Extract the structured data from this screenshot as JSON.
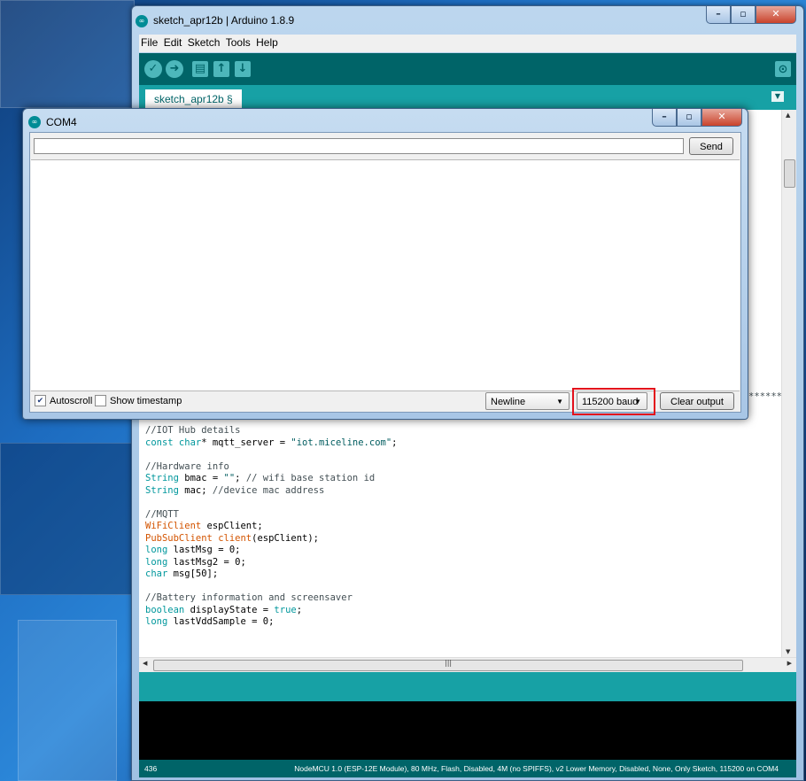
{
  "arduino": {
    "title": "sketch_apr12b | Arduino 1.8.9",
    "menu": [
      "File",
      "Edit",
      "Sketch",
      "Tools",
      "Help"
    ],
    "tab_label": "sketch_apr12b §",
    "code_lines": [
      "//IOT Hub details",
      "const char* mqtt_server = \"iot.miceline.com\";",
      "",
      "//Hardware info",
      "String bmac = \"\"; // wifi base station id",
      "String mac; //device mac address",
      "",
      "//MQTT",
      "WiFiClient espClient;",
      "PubSubClient client(espClient);",
      "long lastMsg = 0;",
      "long lastMsg2 = 0;",
      "char msg[50];",
      "",
      "//Battery information and screensaver",
      "boolean displayState = true;",
      "long lastVddSample = 0;"
    ],
    "stars_fragment": "*******",
    "line_number": "436",
    "board_info": "NodeMCU 1.0 (ESP-12E Module), 80 MHz, Flash, Disabled, 4M (no SPIFFS), v2 Lower Memory, Disabled, None, Only Sketch, 115200 on COM4"
  },
  "serial_monitor": {
    "title": "COM4",
    "input_value": "",
    "send_label": "Send",
    "autoscroll_label": "Autoscroll",
    "autoscroll_checked": true,
    "timestamp_label": "Show timestamp",
    "timestamp_checked": false,
    "line_ending": "Newline",
    "baud_rate": "115200 baud",
    "clear_label": "Clear output"
  },
  "colors": {
    "toolbar": "#006468",
    "tabbar": "#17a1a5",
    "highlight": "#e3101b"
  },
  "icons": [
    "arduino-logo-icon",
    "verify-icon",
    "upload-icon",
    "new-icon",
    "open-icon",
    "save-icon",
    "serial-monitor-icon",
    "minimize-icon",
    "maximize-icon",
    "close-icon",
    "tab-menu-icon",
    "dropdown-arrow-icon"
  ]
}
